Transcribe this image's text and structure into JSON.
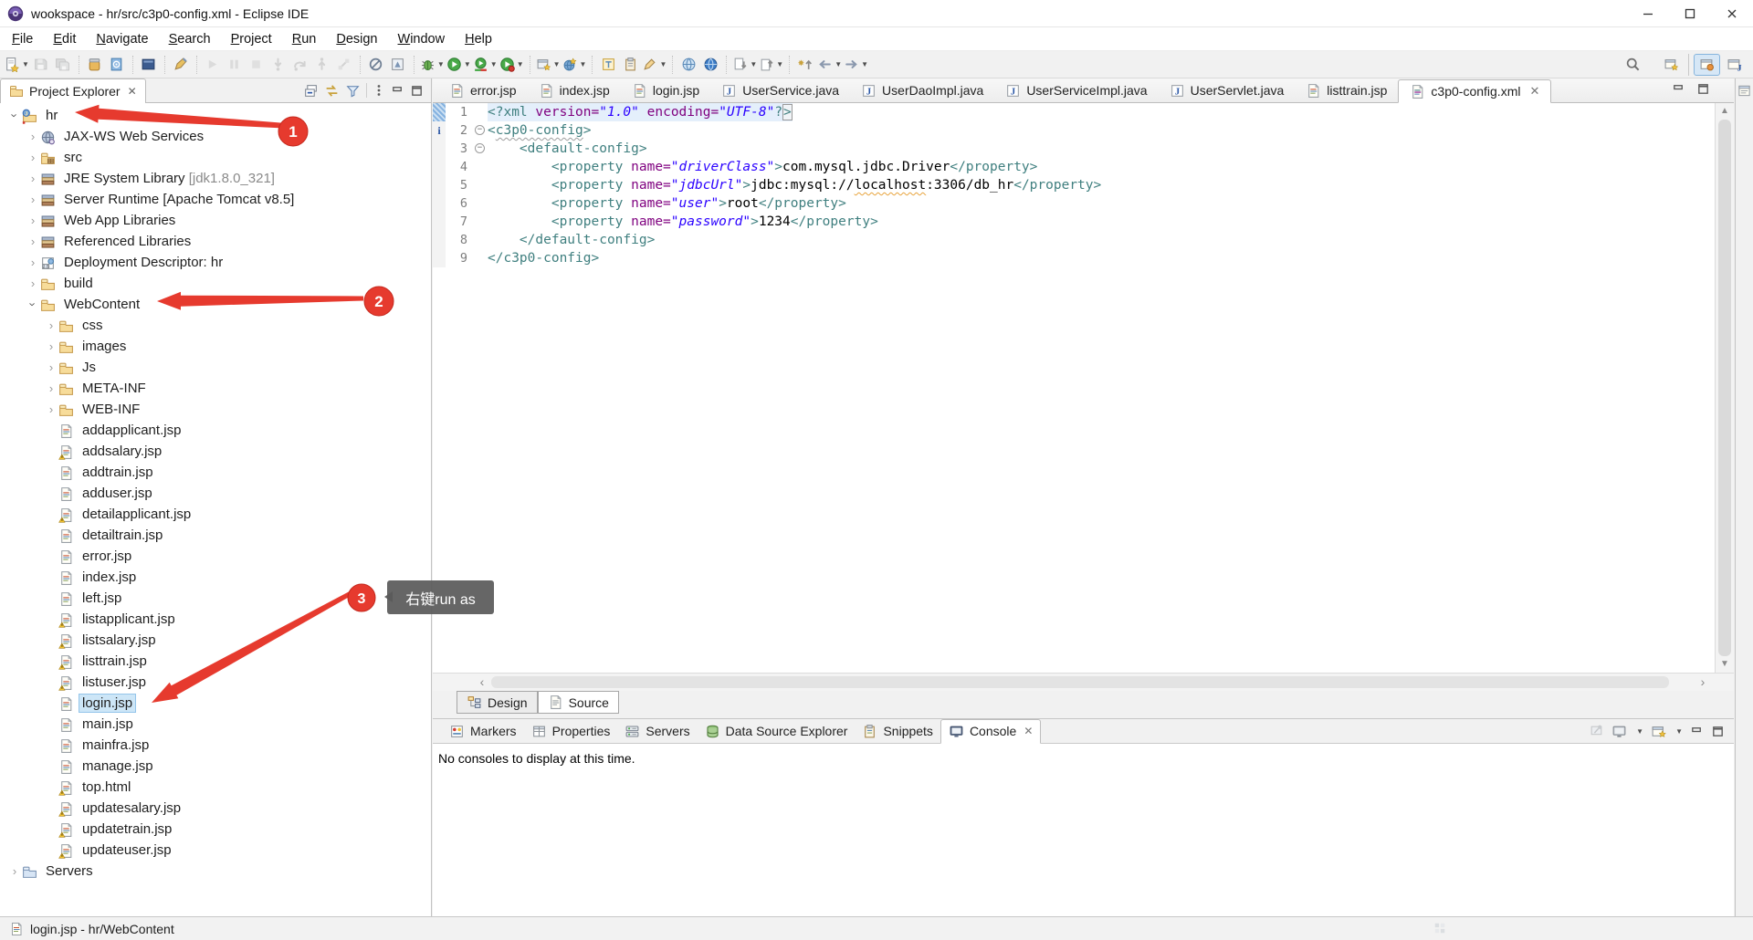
{
  "window": {
    "title": "wookspace - hr/src/c3p0-config.xml - Eclipse IDE"
  },
  "menu": {
    "items": [
      "File",
      "Edit",
      "Navigate",
      "Search",
      "Project",
      "Run",
      "Design",
      "Window",
      "Help"
    ]
  },
  "toolbar": {
    "items": [
      {
        "name": "new-wizard",
        "dropdown": true
      },
      {
        "name": "save",
        "disabled": true
      },
      {
        "name": "save-all",
        "disabled": true
      },
      {
        "name": "separator"
      },
      {
        "name": "jar"
      },
      {
        "name": "javadoc"
      },
      {
        "name": "separator"
      },
      {
        "name": "console-view"
      },
      {
        "name": "separator"
      },
      {
        "name": "pen"
      },
      {
        "name": "separator"
      },
      {
        "name": "resume",
        "disabled": true
      },
      {
        "name": "suspend",
        "disabled": true
      },
      {
        "name": "terminate",
        "disabled": true
      },
      {
        "name": "step-into",
        "disabled": true
      },
      {
        "name": "step-over",
        "disabled": true
      },
      {
        "name": "step-return",
        "disabled": true
      },
      {
        "name": "disconnect",
        "disabled": true
      },
      {
        "name": "separator"
      },
      {
        "name": "skip-breakpoints"
      },
      {
        "name": "external-tools"
      },
      {
        "name": "separator"
      },
      {
        "name": "debug",
        "dropdown": true
      },
      {
        "name": "run",
        "dropdown": true
      },
      {
        "name": "coverage",
        "dropdown": true
      },
      {
        "name": "profile",
        "dropdown": true
      },
      {
        "name": "separator"
      },
      {
        "name": "new-server",
        "dropdown": true
      },
      {
        "name": "web-service",
        "dropdown": true
      },
      {
        "name": "separator"
      },
      {
        "name": "open-type"
      },
      {
        "name": "clipboard"
      },
      {
        "name": "mark-occurrences",
        "dropdown": true
      },
      {
        "name": "separator"
      },
      {
        "name": "browser"
      },
      {
        "name": "browser-blue"
      },
      {
        "name": "separator"
      },
      {
        "name": "next-annotation",
        "dropdown": true
      },
      {
        "name": "prev-annotation",
        "dropdown": true
      },
      {
        "name": "separator"
      },
      {
        "name": "last-edit-location"
      },
      {
        "name": "back",
        "dropdown": true
      },
      {
        "name": "forward",
        "dropdown": true
      }
    ],
    "right": [
      {
        "name": "search"
      },
      {
        "name": "open-perspective"
      },
      {
        "name": "design-perspective",
        "active": true
      },
      {
        "name": "java-perspective"
      }
    ]
  },
  "explorer": {
    "tab": "Project Explorer",
    "tools": [
      "collapse-all",
      "link-editor",
      "filter",
      "view-menu",
      "minimize",
      "maximize"
    ],
    "tree": [
      {
        "d": 0,
        "chev": "exp",
        "icon": "project",
        "label": "hr"
      },
      {
        "d": 1,
        "chev": "col",
        "icon": "jaxws",
        "label": "JAX-WS Web Services"
      },
      {
        "d": 1,
        "chev": "col",
        "icon": "src",
        "label": "src"
      },
      {
        "d": 1,
        "chev": "col",
        "icon": "library",
        "label": "JRE System Library",
        "suffix": " [jdk1.8.0_321]"
      },
      {
        "d": 1,
        "chev": "col",
        "icon": "library",
        "label": "Server Runtime [Apache Tomcat v8.5]"
      },
      {
        "d": 1,
        "chev": "col",
        "icon": "library",
        "label": "Web App Libraries"
      },
      {
        "d": 1,
        "chev": "col",
        "icon": "library",
        "label": "Referenced Libraries"
      },
      {
        "d": 1,
        "chev": "col",
        "icon": "dd",
        "label": "Deployment Descriptor: hr"
      },
      {
        "d": 1,
        "chev": "col",
        "icon": "folder",
        "label": "build"
      },
      {
        "d": 1,
        "chev": "exp",
        "icon": "folder",
        "label": "WebContent"
      },
      {
        "d": 2,
        "chev": "col",
        "icon": "folder",
        "label": "css"
      },
      {
        "d": 2,
        "chev": "col",
        "icon": "folder",
        "label": "images"
      },
      {
        "d": 2,
        "chev": "col",
        "icon": "folder",
        "label": "Js"
      },
      {
        "d": 2,
        "chev": "col",
        "icon": "folder",
        "label": "META-INF"
      },
      {
        "d": 2,
        "chev": "col",
        "icon": "folder",
        "label": "WEB-INF"
      },
      {
        "d": 2,
        "icon": "jsp",
        "label": "addapplicant.jsp"
      },
      {
        "d": 2,
        "icon": "jsp",
        "warn": true,
        "label": "addsalary.jsp"
      },
      {
        "d": 2,
        "icon": "jsp",
        "label": "addtrain.jsp"
      },
      {
        "d": 2,
        "icon": "jsp",
        "label": "adduser.jsp"
      },
      {
        "d": 2,
        "icon": "jsp",
        "warn": true,
        "label": "detailapplicant.jsp"
      },
      {
        "d": 2,
        "icon": "jsp",
        "label": "detailtrain.jsp"
      },
      {
        "d": 2,
        "icon": "jsp",
        "label": "error.jsp"
      },
      {
        "d": 2,
        "icon": "jsp",
        "label": "index.jsp"
      },
      {
        "d": 2,
        "icon": "jsp",
        "label": "left.jsp"
      },
      {
        "d": 2,
        "icon": "jsp",
        "warn": true,
        "label": "listapplicant.jsp"
      },
      {
        "d": 2,
        "icon": "jsp",
        "warn": true,
        "label": "listsalary.jsp"
      },
      {
        "d": 2,
        "icon": "jsp",
        "warn": true,
        "label": "listtrain.jsp"
      },
      {
        "d": 2,
        "icon": "jsp",
        "warn": true,
        "label": "listuser.jsp"
      },
      {
        "d": 2,
        "icon": "jsp",
        "selected": true,
        "label": "login.jsp"
      },
      {
        "d": 2,
        "icon": "jsp",
        "label": "main.jsp"
      },
      {
        "d": 2,
        "icon": "jsp",
        "label": "mainfra.jsp"
      },
      {
        "d": 2,
        "icon": "jsp",
        "label": "manage.jsp"
      },
      {
        "d": 2,
        "icon": "jsp",
        "warn": true,
        "label": "top.html"
      },
      {
        "d": 2,
        "icon": "jsp",
        "warn": true,
        "label": "updatesalary.jsp"
      },
      {
        "d": 2,
        "icon": "jsp",
        "warn": true,
        "label": "updatetrain.jsp"
      },
      {
        "d": 2,
        "icon": "jsp",
        "warn": true,
        "label": "updateuser.jsp"
      },
      {
        "d": 0,
        "chev": "col",
        "icon": "folder-blue",
        "label": "Servers"
      }
    ]
  },
  "editor": {
    "tabs": [
      {
        "label": "error.jsp",
        "icon": "jsp"
      },
      {
        "label": "index.jsp",
        "icon": "jsp"
      },
      {
        "label": "login.jsp",
        "icon": "jsp"
      },
      {
        "label": "UserService.java",
        "icon": "java"
      },
      {
        "label": "UserDaoImpl.java",
        "icon": "java"
      },
      {
        "label": "UserServiceImpl.java",
        "icon": "java"
      },
      {
        "label": "UserServlet.java",
        "icon": "java"
      },
      {
        "label": "listtrain.jsp",
        "icon": "jsp"
      },
      {
        "label": "c3p0-config.xml",
        "icon": "xml",
        "active": true,
        "closable": true
      }
    ],
    "code": {
      "lines": [
        {
          "n": 1,
          "hl": true,
          "marker": "range",
          "tokens": [
            [
              "g",
              "<?xml "
            ],
            [
              "a",
              "version="
            ],
            [
              "v",
              "\"1.0\""
            ],
            [
              "t",
              " "
            ],
            [
              "a",
              "encoding="
            ],
            [
              "v",
              "\"UTF-8\""
            ],
            [
              "g",
              "?"
            ],
            [
              "gb",
              ">"
            ]
          ]
        },
        {
          "n": 2,
          "marker": "info",
          "fold": true,
          "tokens": [
            [
              "g",
              "<"
            ],
            [
              "gw",
              "c3p0-config"
            ],
            [
              "g",
              ">"
            ]
          ]
        },
        {
          "n": 3,
          "fold": true,
          "tokens": [
            [
              "g",
              "    <default-config>"
            ]
          ]
        },
        {
          "n": 4,
          "tokens": [
            [
              "g",
              "        <property "
            ],
            [
              "a",
              "name="
            ],
            [
              "v",
              "\"driverClass\""
            ],
            [
              "g",
              ">"
            ],
            [
              "t",
              "com.mysql.jdbc.Driver"
            ],
            [
              "g",
              "</property>"
            ]
          ]
        },
        {
          "n": 5,
          "tokens": [
            [
              "g",
              "        <property "
            ],
            [
              "a",
              "name="
            ],
            [
              "v",
              "\"jdbcUrl\""
            ],
            [
              "g",
              ">"
            ],
            [
              "t",
              "jdbc:mysql://"
            ],
            [
              "tw",
              "localhost"
            ],
            [
              "t",
              ":3306/db_hr"
            ],
            [
              "g",
              "</property>"
            ]
          ]
        },
        {
          "n": 6,
          "tokens": [
            [
              "g",
              "        <property "
            ],
            [
              "a",
              "name="
            ],
            [
              "v",
              "\"user\""
            ],
            [
              "g",
              ">"
            ],
            [
              "t",
              "root"
            ],
            [
              "g",
              "</property>"
            ]
          ]
        },
        {
          "n": 7,
          "tokens": [
            [
              "g",
              "        <property "
            ],
            [
              "a",
              "name="
            ],
            [
              "v",
              "\"password\""
            ],
            [
              "g",
              ">"
            ],
            [
              "t",
              "1234"
            ],
            [
              "g",
              "</property>"
            ]
          ]
        },
        {
          "n": 8,
          "tokens": [
            [
              "g",
              "    </default-config>"
            ]
          ]
        },
        {
          "n": 9,
          "tokens": [
            [
              "g",
              "</c3p0-config>"
            ]
          ]
        }
      ]
    }
  },
  "page_tabs": {
    "tabs": [
      {
        "label": "Design",
        "icon": "design"
      },
      {
        "label": "Source",
        "icon": "source",
        "active": true
      }
    ]
  },
  "console": {
    "tabs": [
      {
        "label": "Markers",
        "icon": "markers"
      },
      {
        "label": "Properties",
        "icon": "properties"
      },
      {
        "label": "Servers",
        "icon": "servers"
      },
      {
        "label": "Data Source Explorer",
        "icon": "dse"
      },
      {
        "label": "Snippets",
        "icon": "snippets"
      },
      {
        "label": "Console",
        "icon": "console",
        "active": true,
        "closable": true
      }
    ],
    "tools": [
      "pin-console",
      "display-console",
      "open-console",
      "minimize",
      "maximize"
    ],
    "message": "No consoles to display at this time."
  },
  "statusbar": {
    "text": "login.jsp - hr/WebContent"
  },
  "annotations": {
    "badge1": "1",
    "badge2": "2",
    "badge3": "3",
    "tooltip": "右键run as"
  },
  "colors": {
    "annotation_red": "#e63a2e",
    "selection_blue": "#cde6f7",
    "code_tag": "#3f7f7f",
    "code_attr_name": "#7f007f",
    "code_attr_value": "#2a00ff",
    "line_highlight": "#e4effb",
    "tooltip_bg": "#5a5a5a"
  }
}
